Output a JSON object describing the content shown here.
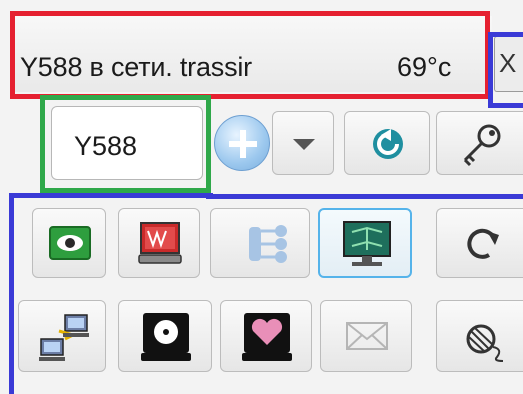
{
  "window": {
    "title": "Y588 в сети. trassir",
    "temperature": "69°c",
    "close_label": "X"
  },
  "device": {
    "name": "Y588"
  },
  "toolbar": {
    "row1": [
      "add-icon",
      "dropdown-arrow-icon",
      "refresh-icon",
      "key-icon"
    ],
    "row2": [
      "eye-icon",
      "monitor-terminal-icon",
      "network-tree-icon",
      "network-monitor-icon",
      "reload-icon"
    ],
    "row3": [
      "network-computers-icon",
      "disk-icon",
      "disk-heart-icon",
      "mail-icon",
      "yarn-icon"
    ]
  },
  "colors": {
    "highlight_title": "#e52030",
    "highlight_device": "#2fa84a",
    "highlight_tools": "#3a3ad6",
    "active_border": "#55b3ea"
  }
}
